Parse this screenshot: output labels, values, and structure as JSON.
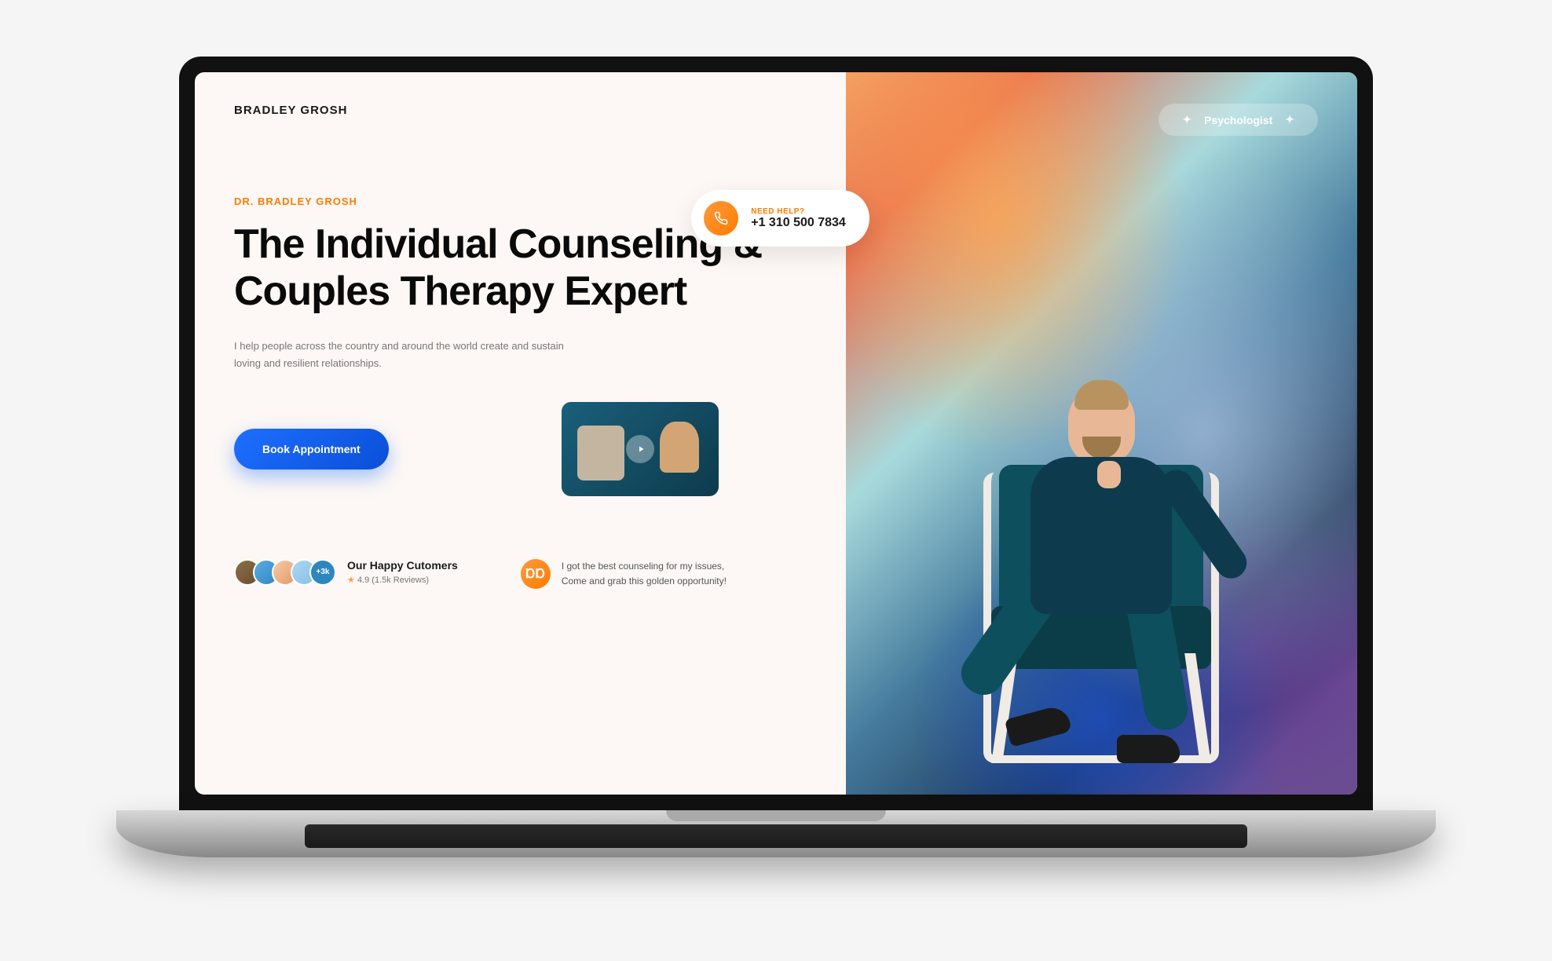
{
  "header": {
    "logo": "BRADLEY GROSH",
    "badge": "Psychologist"
  },
  "help": {
    "label": "NEED HELP?",
    "phone": "+1 310 500 7834"
  },
  "hero": {
    "eyebrow": "DR. BRADLEY GROSH",
    "headline": "The Individual Counseling & Couples Therapy Expert",
    "subtext": "I help people across the country and around the world create and sustain loving and resilient relationships.",
    "cta_label": "Book Appointment"
  },
  "customers": {
    "more_label": "+3k",
    "title": "Our Happy Cutomers",
    "rating_value": "4.9",
    "rating_suffix": "(1.5k Reviews)"
  },
  "testimonial": {
    "quote_glyph": "ⱰⱰ",
    "line1": "I got the best counseling for my issues,",
    "line2": "Come and grab this golden opportunity!"
  }
}
